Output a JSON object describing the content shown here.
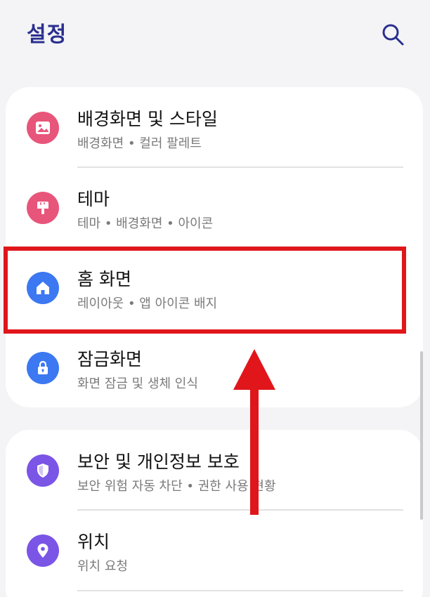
{
  "header": {
    "title": "설정",
    "search_icon": "search-icon"
  },
  "colors": {
    "title": "#2a2f8f",
    "wallpaper_icon_bg": "#e8557a",
    "theme_icon_bg": "#e8557a",
    "home_icon_bg": "#3b78f2",
    "lock_icon_bg": "#3b78f2",
    "security_icon_bg": "#7a55e6",
    "location_icon_bg": "#7a55e6",
    "highlight": "#e0161b",
    "arrow": "#e0161b"
  },
  "groups": [
    {
      "items": [
        {
          "title": "배경화면 및 스타일",
          "subtitle": "배경화면 • 컬러 팔레트",
          "icon": "image-icon"
        },
        {
          "title": "테마",
          "subtitle": "테마 • 배경화면 • 아이콘",
          "icon": "paintbrush-icon"
        },
        {
          "title": "홈 화면",
          "subtitle": "레이아웃 • 앱 아이콘 배지",
          "icon": "home-icon"
        },
        {
          "title": "잠금화면",
          "subtitle": "화면 잠금 및 생체 인식",
          "icon": "lock-icon"
        }
      ]
    },
    {
      "items": [
        {
          "title": "보안 및 개인정보 보호",
          "subtitle": "보안 위험 자동 차단 • 권한 사용 현황",
          "icon": "shield-icon"
        },
        {
          "title": "위치",
          "subtitle": "위치 요청",
          "icon": "location-pin-icon"
        }
      ]
    }
  ],
  "annotation": {
    "highlighted_item": "홈 화면",
    "arrow_direction": "up"
  }
}
